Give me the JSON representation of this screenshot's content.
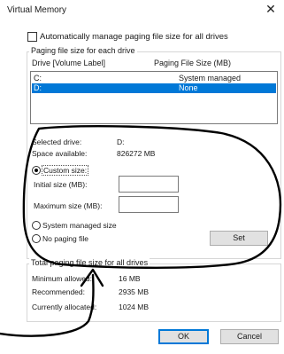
{
  "window": {
    "title": "Virtual Memory"
  },
  "auto_manage": {
    "label": "Automatically manage paging file size for all drives",
    "checked": false
  },
  "paging_group": {
    "legend": "Paging file size for each drive",
    "col_drive": "Drive  [Volume Label]",
    "col_size": "Paging File Size (MB)",
    "rows": [
      {
        "drive": "C:",
        "size": "System managed",
        "selected": false
      },
      {
        "drive": "D:",
        "size": "None",
        "selected": true
      }
    ]
  },
  "drive_info": {
    "selected_drive_label": "Selected drive:",
    "selected_drive_value": "D:",
    "space_available_label": "Space available:",
    "space_available_value": "826272 MB"
  },
  "size_options": {
    "custom_size_label": "Custom size:",
    "initial_size_label": "Initial size (MB):",
    "initial_size_value": "",
    "maximum_size_label": "Maximum size (MB):",
    "maximum_size_value": "",
    "system_managed_label": "System managed size",
    "no_paging_label": "No paging file",
    "selected_option": "custom",
    "set_button": "Set"
  },
  "total_group": {
    "legend": "Total paging file size for all drives",
    "minimum_label": "Minimum allowed:",
    "minimum_value": "16 MB",
    "recommended_label": "Recommended:",
    "recommended_value": "2935 MB",
    "current_label": "Currently allocated:",
    "current_value": "1024 MB"
  },
  "buttons": {
    "ok": "OK",
    "cancel": "Cancel"
  },
  "colors": {
    "selection": "#0078d7",
    "annotation_ink": "#000000"
  }
}
